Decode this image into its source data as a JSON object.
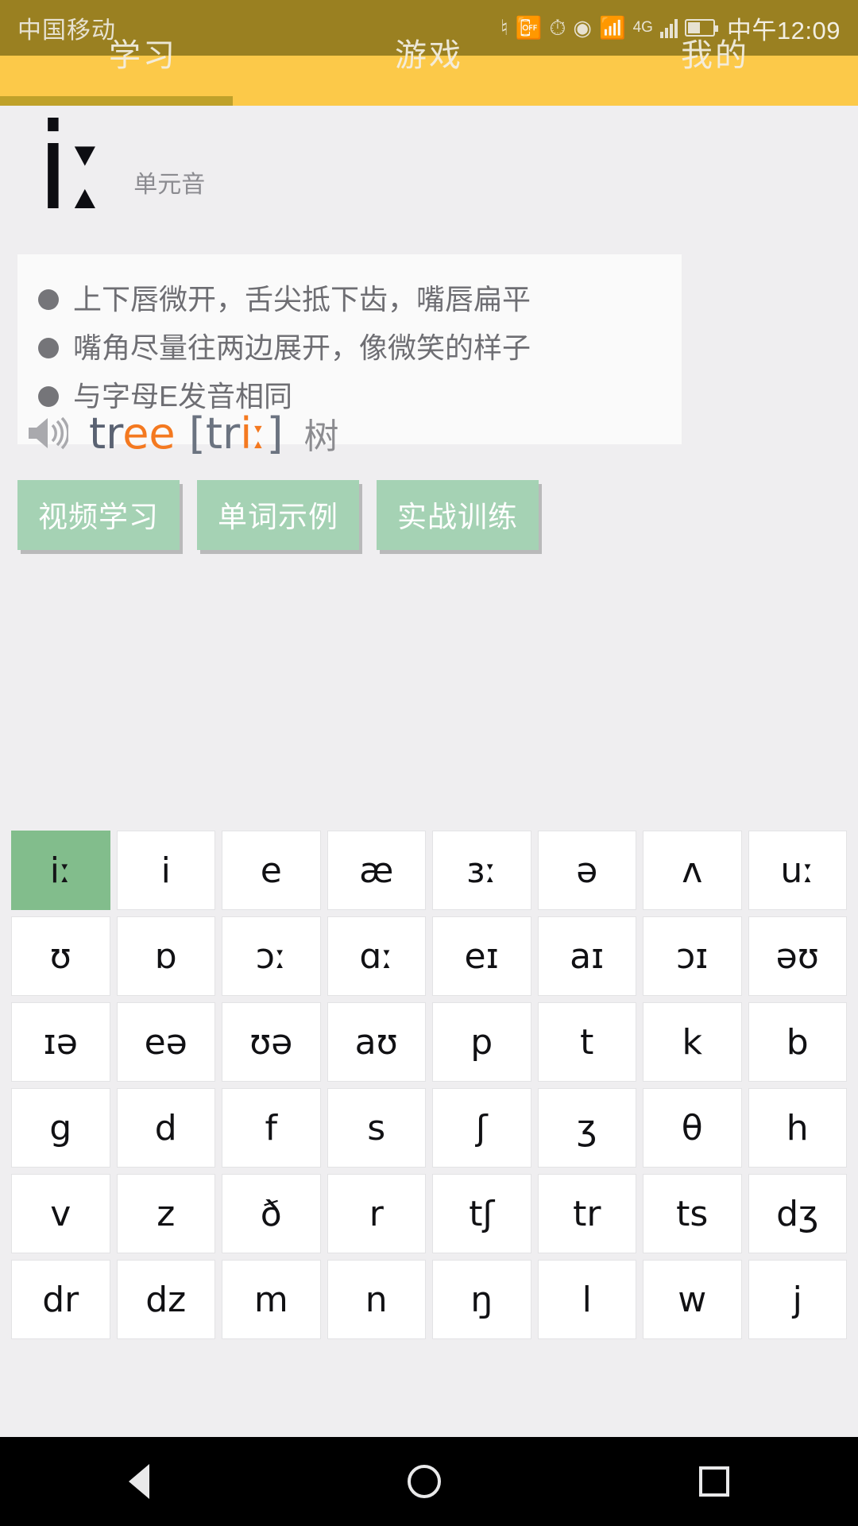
{
  "status_bar": {
    "carrier": "中国移动",
    "time": "中午12:09",
    "network": "4G",
    "icons": [
      "nfc-icon",
      "vibrate-icon",
      "alarm-icon",
      "eye-care-icon",
      "wifi-icon",
      "signal-icon",
      "battery-icon"
    ]
  },
  "tabs": {
    "items": [
      {
        "label": "学习",
        "active": true
      },
      {
        "label": "游戏",
        "active": false
      },
      {
        "label": "我的",
        "active": false
      }
    ]
  },
  "header": {
    "symbol": "iː",
    "type_label": "单元音"
  },
  "description": {
    "bullets": [
      "上下唇微开，舌尖抵下齿，嘴唇扁平",
      "嘴角尽量往两边展开，像微笑的样子",
      "与字母E发音相同"
    ]
  },
  "example": {
    "speaker_icon": "speaker-icon",
    "word_prefix": "tr",
    "word_highlight": "ee",
    "phonetic_open": " [tr",
    "phonetic_highlight": "iː",
    "phonetic_close": "]",
    "translation": "树"
  },
  "actions": {
    "buttons": [
      {
        "label": "视频学习"
      },
      {
        "label": "单词示例"
      },
      {
        "label": "实战训练"
      }
    ]
  },
  "phonetic_grid": {
    "columns": 8,
    "selected": "iː",
    "cells": [
      "iː",
      "i",
      "e",
      "æ",
      "ɜː",
      "ə",
      "ʌ",
      "uː",
      "ʊ",
      "ɒ",
      "ɔː",
      "ɑː",
      "eɪ",
      "aɪ",
      "ɔɪ",
      "əʊ",
      "ɪə",
      "eə",
      "ʊə",
      "aʊ",
      "p",
      "t",
      "k",
      "b",
      "g",
      "d",
      "f",
      "s",
      "ʃ",
      "ʒ",
      "θ",
      "h",
      "v",
      "z",
      "ð",
      "r",
      "tʃ",
      "tr",
      "ts",
      "dʒ",
      "dr",
      "dz",
      "m",
      "n",
      "ŋ",
      "l",
      "w",
      "j"
    ]
  },
  "nav_bar": {
    "back": "back-icon",
    "home": "home-icon",
    "recent": "recent-apps-icon"
  },
  "colors": {
    "status_bar": "#9a8021",
    "tab_bar": "#fcc949",
    "tab_indicator": "#bfa12a",
    "accent_orange": "#f47920",
    "button_green": "#a5d2b4",
    "selected_green": "#82bd8c",
    "page_background": "#efeef0"
  }
}
